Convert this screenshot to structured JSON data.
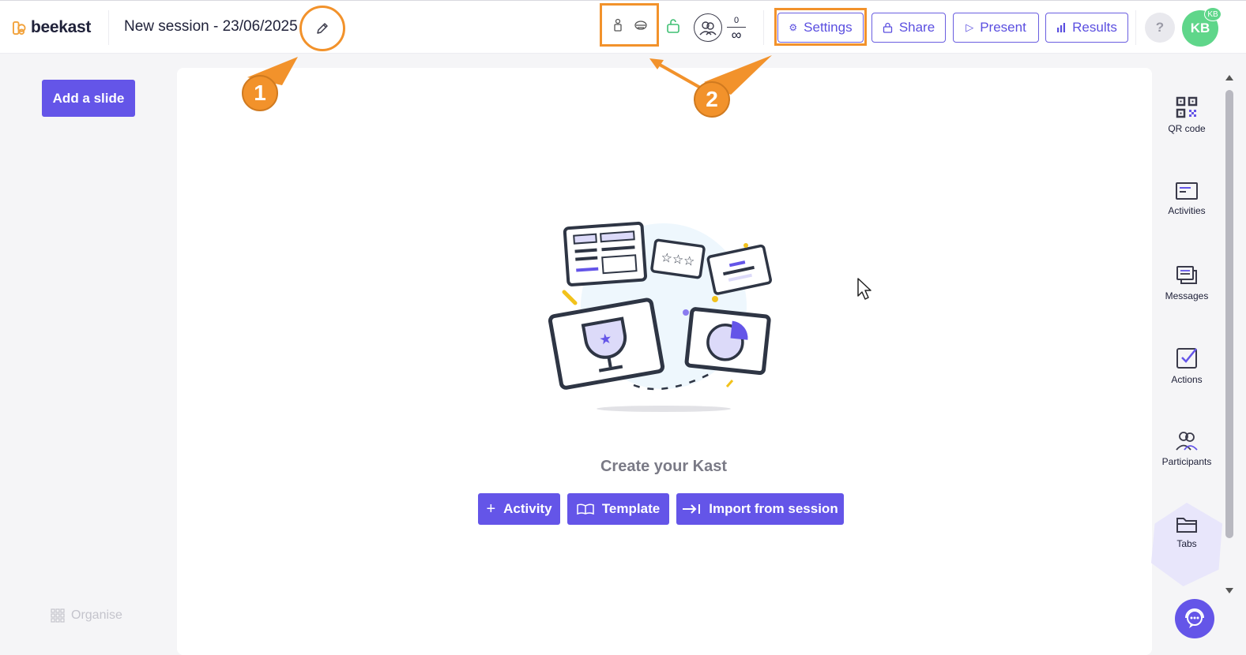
{
  "header": {
    "logo_text": "beekast",
    "session_title": "New session - 23/06/2025",
    "participants_count": "0",
    "participants_limit": "∞",
    "buttons": {
      "settings": "Settings",
      "share": "Share",
      "present": "Present",
      "results": "Results"
    },
    "help_label": "?",
    "avatar_initials": "KB",
    "avatar_badge": "KB"
  },
  "left_panel": {
    "add_slide": "Add a slide",
    "organise": "Organise"
  },
  "canvas": {
    "create_title": "Create your Kast",
    "actions": {
      "activity": "Activity",
      "template": "Template",
      "import": "Import from session"
    }
  },
  "sidebar": {
    "items": [
      {
        "label": "QR code",
        "icon": "qr-code-icon"
      },
      {
        "label": "Activities",
        "icon": "activities-icon"
      },
      {
        "label": "Messages",
        "icon": "messages-icon"
      },
      {
        "label": "Actions",
        "icon": "actions-icon"
      },
      {
        "label": "Participants",
        "icon": "participants-icon"
      },
      {
        "label": "Tabs",
        "icon": "tabs-icon"
      }
    ]
  },
  "callouts": {
    "one": "1",
    "two": "2"
  },
  "colors": {
    "accent": "#6455e8",
    "highlight": "#f2922b",
    "avatar": "#5fd68a"
  }
}
